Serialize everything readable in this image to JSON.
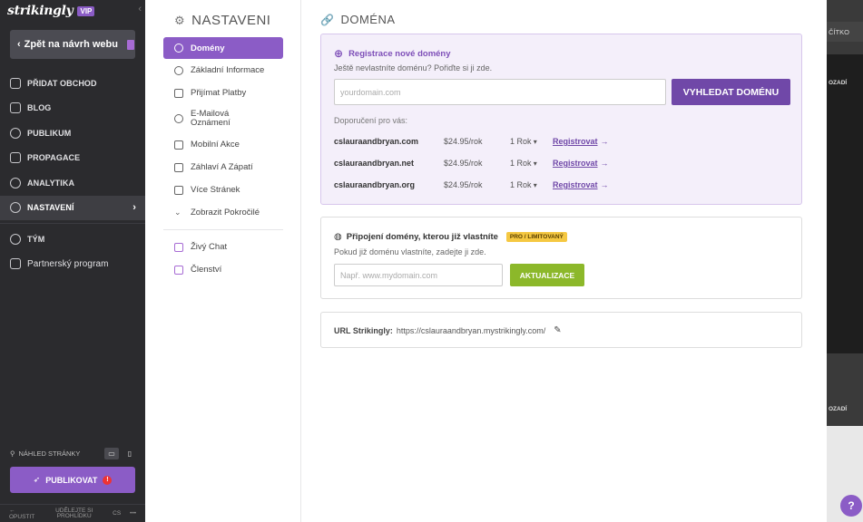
{
  "sidebar": {
    "logo": "strikingly",
    "vip": "VIP",
    "back_label": "Zpět na návrh webu",
    "items": [
      {
        "label": "PŘIDAT OBCHOD",
        "icon": "store-icon"
      },
      {
        "label": "BLOG",
        "icon": "pen-icon"
      },
      {
        "label": "PUBLIKUM",
        "icon": "people-icon"
      },
      {
        "label": "PROPAGACE",
        "icon": "megaphone-icon"
      },
      {
        "label": "ANALYTIKA",
        "icon": "pie-chart-icon"
      },
      {
        "label": "NASTAVENÍ",
        "icon": "gear-icon"
      }
    ],
    "team_label": "TÝM",
    "partner_label": "Partnerský program",
    "preview_label": "NÁHLED STRÁNKY",
    "publish_label": "PUBLIKOVAT",
    "bottom": {
      "leave": "OPUSTIT",
      "help": "UDĚLEJTE SI PROHLÍDKU",
      "lang": "CS"
    }
  },
  "settings_menu": {
    "title": "NASTAVENI",
    "items": [
      {
        "label": "Domény",
        "icon": "globe-icon"
      },
      {
        "label": "Základní Informace",
        "icon": "info-icon"
      },
      {
        "label": "Přijímat Platby",
        "icon": "card-icon"
      },
      {
        "label": "E-Mailová Oznámení",
        "icon": "bell-icon"
      },
      {
        "label": "Mobilní Akce",
        "icon": "mobile-icon"
      },
      {
        "label": "Záhlaví A Zápatí",
        "icon": "layout-icon"
      },
      {
        "label": "Více Stránek",
        "icon": "pages-icon"
      },
      {
        "label": "Zobrazit Pokročilé",
        "icon": "chevron-down-icon"
      }
    ],
    "extra": [
      {
        "label": "Živý Chat",
        "icon": "chat-icon"
      },
      {
        "label": "Členství",
        "icon": "member-icon"
      }
    ]
  },
  "domain": {
    "title": "DOMÉNA",
    "register": {
      "heading": "Registrace nové domény",
      "subtitle": "Ještě nevlastníte doménu? Pořiďte si ji zde.",
      "placeholder": "yourdomain.com",
      "search_label": "VYHLEDAT DOMÉNU",
      "recommend_label": "Doporučení pro vás:",
      "suggestions": [
        {
          "domain": "cslauraandbryan.com",
          "price": "$24.95/rok",
          "term": "1 Rok",
          "action": "Registrovat"
        },
        {
          "domain": "cslauraandbryan.net",
          "price": "$24.95/rok",
          "term": "1 Rok",
          "action": "Registrovat"
        },
        {
          "domain": "cslauraandbryan.org",
          "price": "$24.95/rok",
          "term": "1 Rok",
          "action": "Registrovat"
        }
      ]
    },
    "connect": {
      "heading": "Připojení domény, kterou již vlastníte",
      "badge": "PRO / LIMITOVANÝ",
      "subtitle": "Pokud již doménu vlastníte, zadejte ji zde.",
      "placeholder": "Např. www.mydomain.com",
      "button_label": "AKTUALIZACE"
    },
    "url": {
      "label": "URL Strikingly:",
      "value": "https://cslauraandbryan.mystrikingly.com/"
    }
  },
  "editor_peek": {
    "label_a": "ČÍTKO",
    "label_b": "OZADÍ",
    "label_c": "OZADÍ",
    "help": "?"
  },
  "colors": {
    "accent": "#8b5cc6",
    "update": "#8cb82a",
    "badge": "#f5c842"
  }
}
